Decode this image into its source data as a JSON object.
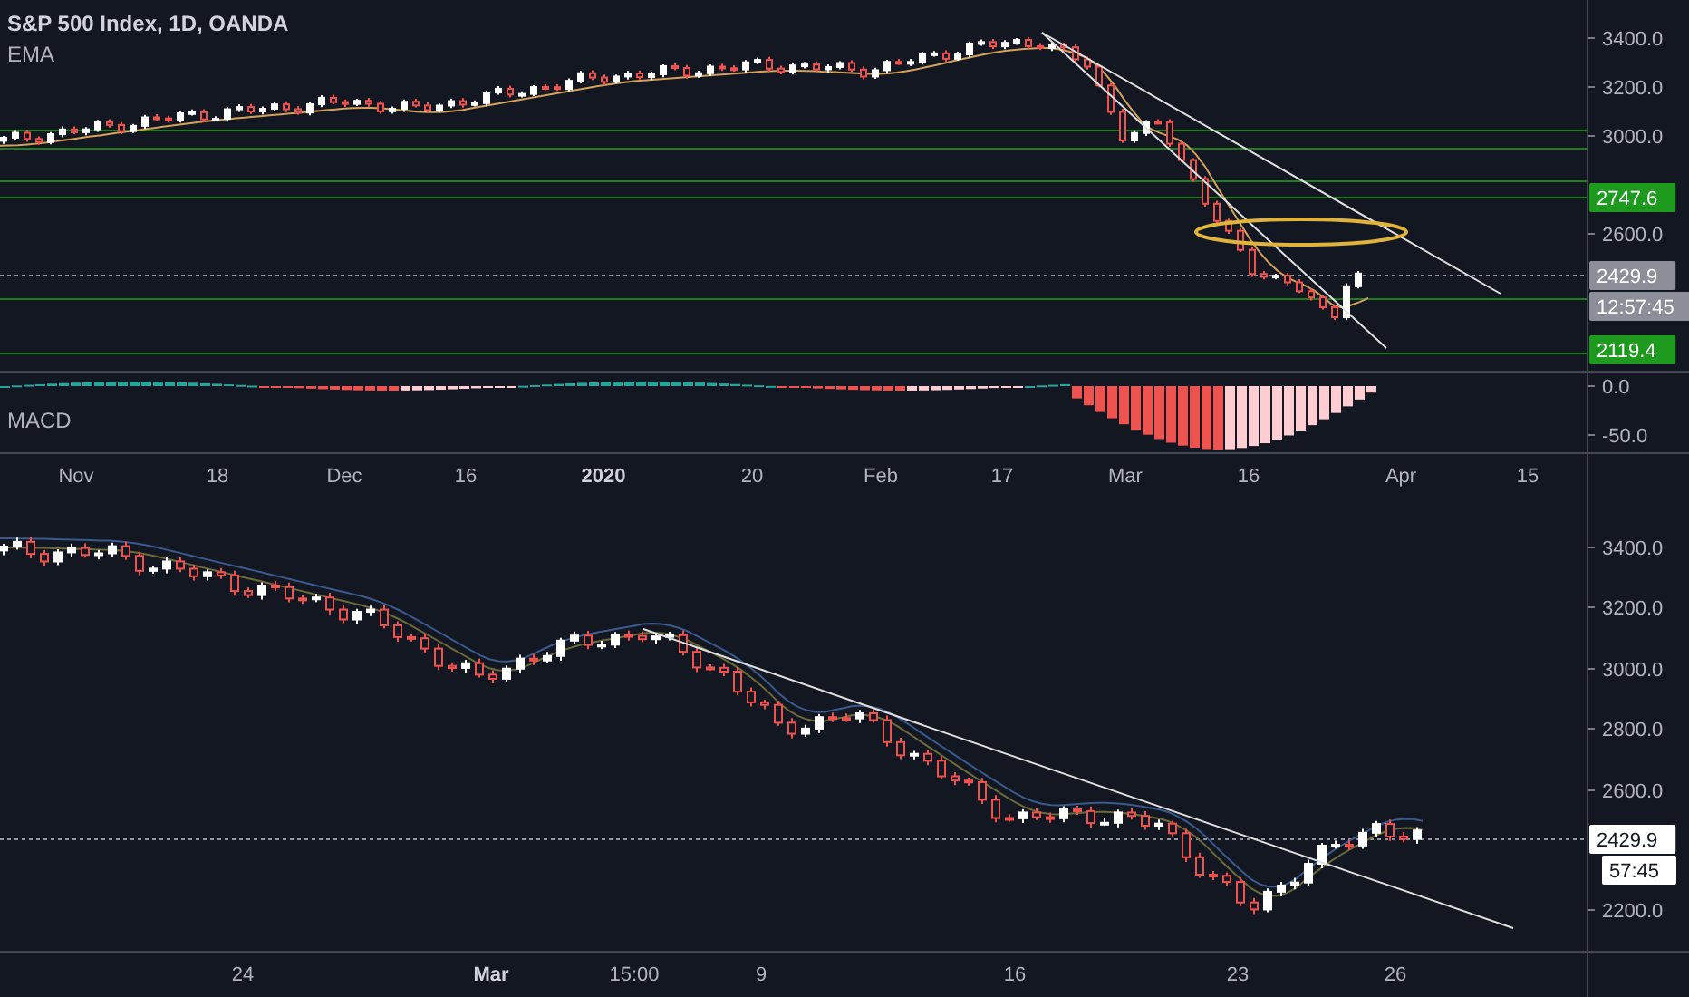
{
  "chart_title": "S&P 500 Index, 1D, OANDA",
  "indicator": "EMA",
  "top_pane": {
    "price_axis": [
      "3400.0",
      "3200.0",
      "3000.0",
      "2600.0"
    ],
    "price_tags": [
      {
        "text": "2747.6",
        "color": "#1e9b1e"
      },
      {
        "text": "2429.9",
        "color": "#8c8f99"
      },
      {
        "text": "12:57:45",
        "color": "#8c8f99"
      },
      {
        "text": "2119.4",
        "color": "#1e9b1e"
      }
    ]
  },
  "macd_pane": {
    "label": "MACD",
    "axis": [
      "0.0",
      "-50.0"
    ]
  },
  "top_time_axis": [
    {
      "label": "Nov",
      "bold": false
    },
    {
      "label": "18",
      "bold": false
    },
    {
      "label": "Dec",
      "bold": false
    },
    {
      "label": "16",
      "bold": false
    },
    {
      "label": "2020",
      "bold": true
    },
    {
      "label": "20",
      "bold": false
    },
    {
      "label": "Feb",
      "bold": false
    },
    {
      "label": "17",
      "bold": false
    },
    {
      "label": "Mar",
      "bold": false
    },
    {
      "label": "16",
      "bold": false
    },
    {
      "label": "Apr",
      "bold": false
    },
    {
      "label": "15",
      "bold": false
    }
  ],
  "bottom_pane": {
    "price_axis": [
      "3400.0",
      "3200.0",
      "3000.0",
      "2800.0",
      "2600.0",
      "2200.0"
    ],
    "price_tags": [
      {
        "text": "2429.9",
        "color": "#ffffff"
      },
      {
        "text": "57:45",
        "color": "#ffffff"
      }
    ]
  },
  "bottom_time_axis": [
    {
      "label": "24",
      "bold": false
    },
    {
      "label": "Mar",
      "bold": true
    },
    {
      "label": "15:00",
      "bold": false
    },
    {
      "label": "9",
      "bold": false
    },
    {
      "label": "16",
      "bold": false
    },
    {
      "label": "23",
      "bold": false
    },
    {
      "label": "26",
      "bold": false
    }
  ]
}
